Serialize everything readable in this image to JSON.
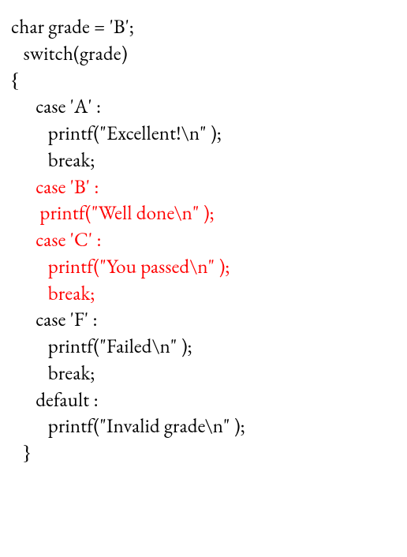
{
  "code": {
    "l1": "char grade = 'B';",
    "l2": "   switch(grade)",
    "l3": "{",
    "l4": "      case 'A' :",
    "l5": "         printf(\"Excellent!\\n\" );",
    "l6": "         break;",
    "l7": "      case 'B' :",
    "l8": "       printf(\"Well done\\n\" );",
    "l9": "      case 'C' :",
    "l10": "         printf(\"You passed\\n\" );",
    "l11": "         break;",
    "l12": "      case 'F' :",
    "l13": "         printf(\"Failed\\n\" );",
    "l14": "         break;",
    "l15": "      default :",
    "l16": "         printf(\"Invalid grade\\n\" );",
    "l17": "   }"
  },
  "colors": {
    "highlight": "#ff0000",
    "normal": "#000000"
  }
}
